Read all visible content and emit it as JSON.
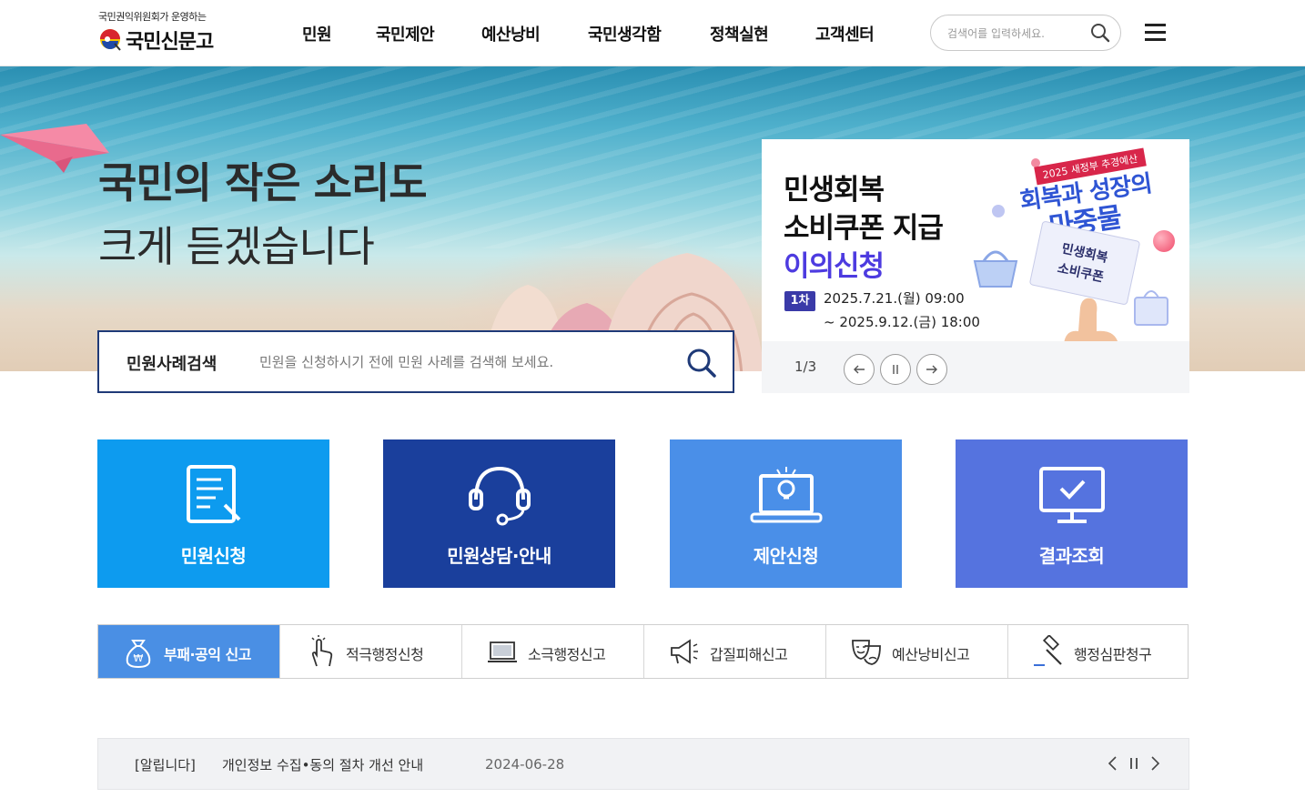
{
  "header": {
    "logo_subtitle": "국민권익위원회가 운영하는",
    "logo_text": "국민신문고",
    "nav": [
      "민원",
      "국민제안",
      "예산낭비",
      "국민생각함",
      "정책실현",
      "고객센터"
    ],
    "search_placeholder": "검색어를 입력하세요."
  },
  "hero": {
    "title_line1": "국민의 작은 소리도",
    "title_line2": "크게 듣겠습니다",
    "search_label": "민원사례검색",
    "search_placeholder": "민원을 신청하시기 전에 민원 사례를 검색해 보세요."
  },
  "banner": {
    "line1": "민생회복",
    "line2": "소비쿠폰 지급",
    "line3": "이의신청",
    "round_badge": "1차",
    "date_line1": "2025.7.21.(월) 09:00",
    "date_line2": "~ 2025.9.12.(금) 18:00",
    "tag": "2025 새정부 추경예산",
    "slogan1": "회복과 성장의",
    "slogan2": "마중물",
    "coupon_line1": "민생회복",
    "coupon_line2": "소비쿠폰",
    "pager": "1/3",
    "colors": {
      "purple": "#4d3be0",
      "slogan_blue": "#2f55d4"
    }
  },
  "tiles": [
    {
      "label": "민원신청",
      "color": "#0d9bef",
      "icon": "document-pen-icon"
    },
    {
      "label": "민원상담·안내",
      "color": "#1a3f9c",
      "icon": "headset-icon"
    },
    {
      "label": "제안신청",
      "color": "#4a8fe8",
      "icon": "laptop-idea-icon"
    },
    {
      "label": "결과조회",
      "color": "#5573df",
      "icon": "monitor-check-icon"
    }
  ],
  "quick_reports": [
    {
      "label": "부패·공익 신고",
      "icon": "money-bag-icon",
      "active": true
    },
    {
      "label": "적극행정신청",
      "icon": "hand-click-icon",
      "active": false
    },
    {
      "label": "소극행정신고",
      "icon": "laptop-icon",
      "active": false
    },
    {
      "label": "갑질피해신고",
      "icon": "megaphone-icon",
      "active": false
    },
    {
      "label": "예산낭비신고",
      "icon": "masks-icon",
      "active": false
    },
    {
      "label": "행정심판청구",
      "icon": "gavel-icon",
      "active": false
    }
  ],
  "notice": {
    "category": "[알립니다]",
    "title": "개인정보 수집•동의 절차 개선 안내",
    "date": "2024-06-28"
  }
}
